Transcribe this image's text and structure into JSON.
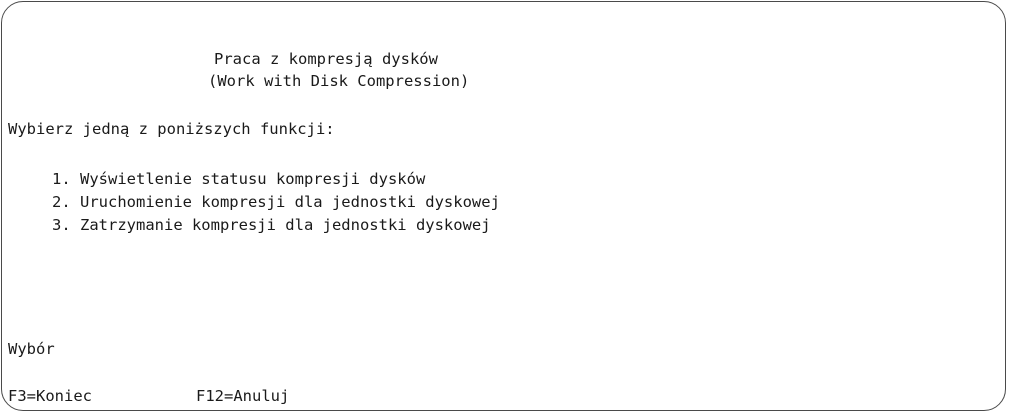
{
  "screen": {
    "title": "Praca z kompresją dysków",
    "subtitle": "(Work with Disk Compression)",
    "prompt": "Wybierz jedną z poniższych funkcji:",
    "options": [
      {
        "number": "1.",
        "label": "1. Wyświetlenie statusu kompresji dysków"
      },
      {
        "number": "2.",
        "label": "2. Uruchomienie kompresji dla jednostki dyskowej"
      },
      {
        "number": "3.",
        "label": "3. Zatrzymanie kompresji dla jednostki dyskowej"
      }
    ],
    "choice_label": "Wybór",
    "choice_value": ""
  },
  "function_keys": [
    {
      "key": "F3",
      "label": "F3=Koniec"
    },
    {
      "key": "F12",
      "label": "F12=Anuluj"
    }
  ]
}
